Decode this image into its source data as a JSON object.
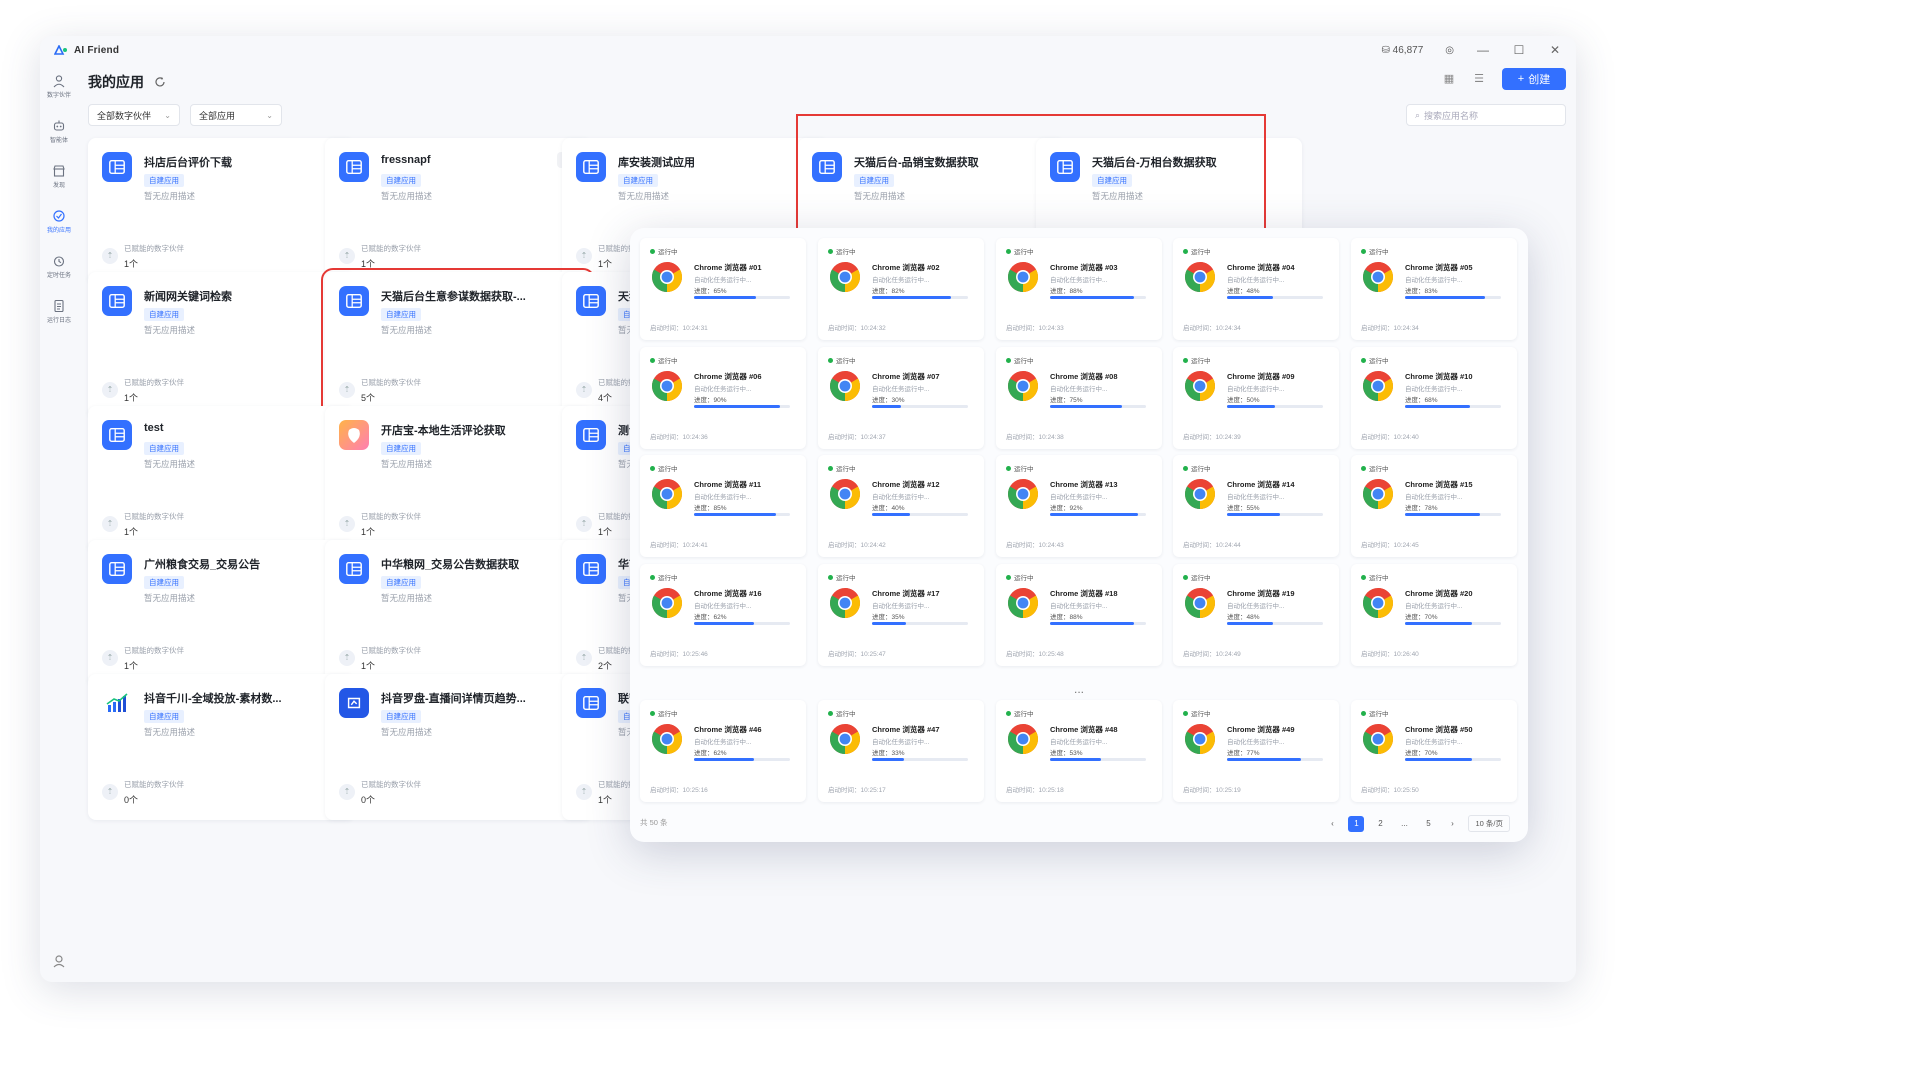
{
  "window": {
    "title": "AI Friend",
    "token_count": "46,877",
    "controls": [
      "—",
      "☐",
      "✕"
    ]
  },
  "sidebar": {
    "items": [
      {
        "label": "数字伙伴",
        "icon": "person-icon"
      },
      {
        "label": "智能体",
        "icon": "robot-icon"
      },
      {
        "label": "发现",
        "icon": "store-icon"
      },
      {
        "label": "我的应用",
        "icon": "app-icon",
        "active": true
      },
      {
        "label": "定时任务",
        "icon": "clock-icon"
      },
      {
        "label": "运行日志",
        "icon": "log-icon"
      }
    ]
  },
  "header": {
    "title": "我的应用",
    "create_label": "创建",
    "search_placeholder": "搜索应用名称"
  },
  "filters": {
    "partner": "全部数字伙伴",
    "apps": "全部应用"
  },
  "card_common": {
    "tag": "自建应用",
    "desc": "暂无应用描述",
    "partner_label": "已赋能的数字伙伴"
  },
  "cards": [
    {
      "name": "抖店后台评价下载",
      "count": "1个",
      "icon": "app-icon"
    },
    {
      "name": "fressnapf",
      "count": "1个",
      "icon": "app-icon"
    },
    {
      "name": "库安装测试应用",
      "count": "1个",
      "icon": "app-icon"
    },
    {
      "name": "天猫后台-品销宝数据获取",
      "count": "",
      "icon": "app-icon"
    },
    {
      "name": "天猫后台-万相台数据获取",
      "count": "",
      "icon": "app-icon"
    },
    {
      "name": "新闻网关键词检索",
      "count": "1个",
      "icon": "app-icon"
    },
    {
      "name": "天猫后台生意参谋数据获取-...",
      "count": "5个",
      "icon": "app-icon"
    },
    {
      "name": "天猫",
      "count": "4个",
      "icon": "app-icon"
    },
    {
      "name": "test",
      "count": "1个",
      "icon": "app-icon"
    },
    {
      "name": "开店宝-本地生活评论获取",
      "count": "1个",
      "icon": "app-orange-icon"
    },
    {
      "name": "测试",
      "count": "1个",
      "icon": "app-icon"
    },
    {
      "name": "广州粮食交易_交易公告",
      "count": "1个",
      "icon": "app-icon"
    },
    {
      "name": "中华粮网_交易公告数据获取",
      "count": "1个",
      "icon": "app-icon"
    },
    {
      "name": "华南",
      "count": "2个",
      "icon": "app-icon"
    },
    {
      "name": "抖音千川-全域投放-素材数...",
      "count": "0个",
      "icon": "chart-icon"
    },
    {
      "name": "抖音罗盘-直播间详情页趋势...",
      "count": "0个",
      "icon": "app-blue-icon"
    },
    {
      "name": "联营",
      "count": "1个",
      "icon": "app-icon"
    }
  ],
  "instances": {
    "status": "运行中",
    "subtitle": "自动化任务运行中...",
    "progress_prefix": "进度：",
    "time_prefix": "启动时间：",
    "items": [
      {
        "name": "Chrome 浏览器 #01",
        "progress": 65,
        "progress_text": "65%",
        "time": "10:24:31"
      },
      {
        "name": "Chrome 浏览器 #02",
        "progress": 82,
        "progress_text": "82%",
        "time": "10:24:32"
      },
      {
        "name": "Chrome 浏览器 #03",
        "progress": 88,
        "progress_text": "88%",
        "time": "10:24:33"
      },
      {
        "name": "Chrome 浏览器 #04",
        "progress": 48,
        "progress_text": "48%",
        "time": "10:24:34"
      },
      {
        "name": "Chrome 浏览器 #05",
        "progress": 83,
        "progress_text": "83%",
        "time": "10:24:34"
      },
      {
        "name": "Chrome 浏览器 #06",
        "progress": 90,
        "progress_text": "90%",
        "time": "10:24:36"
      },
      {
        "name": "Chrome 浏览器 #07",
        "progress": 30,
        "progress_text": "30%",
        "time": "10:24:37"
      },
      {
        "name": "Chrome 浏览器 #08",
        "progress": 75,
        "progress_text": "75%",
        "time": "10:24:38"
      },
      {
        "name": "Chrome 浏览器 #09",
        "progress": 50,
        "progress_text": "50%",
        "time": "10:24:39"
      },
      {
        "name": "Chrome 浏览器 #10",
        "progress": 68,
        "progress_text": "68%",
        "time": "10:24:40"
      },
      {
        "name": "Chrome 浏览器 #11",
        "progress": 85,
        "progress_text": "85%",
        "time": "10:24:41"
      },
      {
        "name": "Chrome 浏览器 #12",
        "progress": 40,
        "progress_text": "40%",
        "time": "10:24:42"
      },
      {
        "name": "Chrome 浏览器 #13",
        "progress": 92,
        "progress_text": "92%",
        "time": "10:24:43"
      },
      {
        "name": "Chrome 浏览器 #14",
        "progress": 55,
        "progress_text": "55%",
        "time": "10:24:44"
      },
      {
        "name": "Chrome 浏览器 #15",
        "progress": 78,
        "progress_text": "78%",
        "time": "10:24:45"
      },
      {
        "name": "Chrome 浏览器 #16",
        "progress": 62,
        "progress_text": "62%",
        "time": "10:25:46"
      },
      {
        "name": "Chrome 浏览器 #17",
        "progress": 35,
        "progress_text": "35%",
        "time": "10:25:47"
      },
      {
        "name": "Chrome 浏览器 #18",
        "progress": 88,
        "progress_text": "88%",
        "time": "10:25:48"
      },
      {
        "name": "Chrome 浏览器 #19",
        "progress": 48,
        "progress_text": "48%",
        "time": "10:24:49"
      },
      {
        "name": "Chrome 浏览器 #20",
        "progress": 70,
        "progress_text": "70%",
        "time": "10:26:40"
      },
      {
        "name": "Chrome 浏览器 #46",
        "progress": 62,
        "progress_text": "62%",
        "time": "10:25:16"
      },
      {
        "name": "Chrome 浏览器 #47",
        "progress": 33,
        "progress_text": "33%",
        "time": "10:25:17"
      },
      {
        "name": "Chrome 浏览器 #48",
        "progress": 53,
        "progress_text": "53%",
        "time": "10:25:18"
      },
      {
        "name": "Chrome 浏览器 #49",
        "progress": 77,
        "progress_text": "77%",
        "time": "10:25:19"
      },
      {
        "name": "Chrome 浏览器 #50",
        "progress": 70,
        "progress_text": "70%",
        "time": "10:25:50"
      }
    ],
    "ellipsis": "...",
    "total": "共 50 条",
    "pagination": {
      "prev": "‹",
      "pages": [
        "1",
        "2",
        "...",
        "5"
      ],
      "active_page": "1",
      "next": "›",
      "page_size": "10 条/页"
    }
  },
  "colors": {
    "accent": "#3370ff",
    "highlight": "#e53935",
    "running": "#22b14c"
  }
}
